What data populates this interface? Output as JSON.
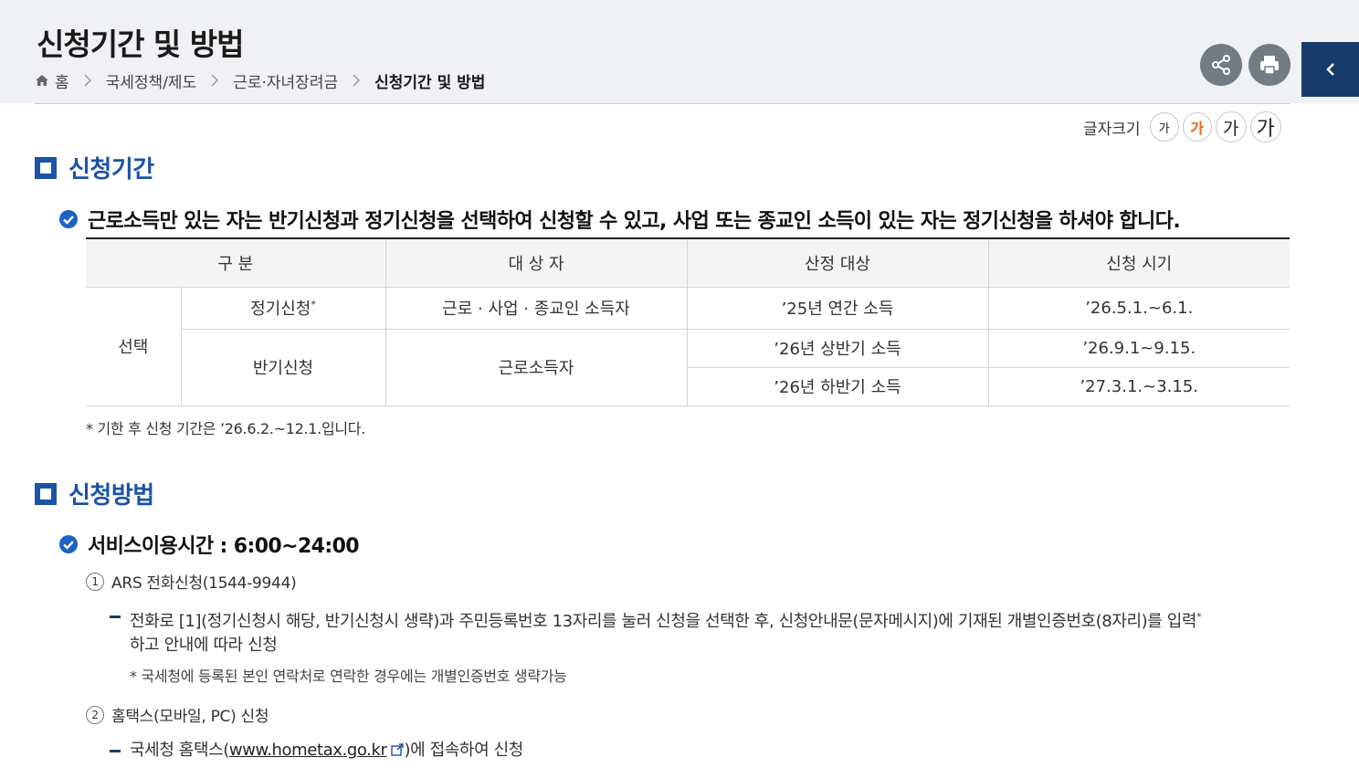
{
  "page": {
    "title": "신청기간 및 방법"
  },
  "breadcrumb": {
    "items": [
      "홈",
      "국세정책/제도",
      "근로·자녀장려금"
    ],
    "current": "신청기간 및 방법"
  },
  "toolbar": {
    "font_size_label": "글자크기",
    "font_size_options": [
      "가",
      "가",
      "가",
      "가"
    ]
  },
  "period_section": {
    "heading": "신청기간",
    "notice": "근로소득만 있는 자는 반기신청과 정기신청을 선택하여 신청할 수 있고, 사업 또는 종교인 소득이 있는 자는 정기신청을 하셔야 합니다.",
    "table": {
      "headers": [
        "구 분",
        "대 상 자",
        "산정 대상",
        "신청 시기"
      ],
      "group_label": "선택",
      "regular": {
        "label": "정기신청",
        "mark": "*",
        "target": "근로 · 사업 · 종교인 소득자",
        "basis": "’25년 연간 소득",
        "period": "’26.5.1.~6.1."
      },
      "half": {
        "label": "반기신청",
        "target": "근로소득자",
        "rows": [
          {
            "basis": "’26년 상반기 소득",
            "period": "’26.9.1~9.15."
          },
          {
            "basis": "’26년 하반기 소득",
            "period": "’27.3.1.~3.15."
          }
        ]
      }
    },
    "note": "* 기한 후 신청 기간은 ’26.6.2.~12.1.입니다."
  },
  "method_section": {
    "heading": "신청방법",
    "service_hours": "서비스이용시간 : 6:00~24:00",
    "items": [
      {
        "number": "1",
        "title": "ARS 전화신청(1544-9944)",
        "detail_line1": "전화로 [1](정기신청시 해당, 반기신청시 생략)과 주민등록번호 13자리를 눌러 신청을 선택한 후, 신청안내문(문자메시지)에 기재된 개별인증번호(8자리)를 입력",
        "detail_mark": "*",
        "detail_line2": "하고 안내에 따라 신청",
        "sub_note": "* 국세청에 등록된 본인 연락처로 연락한 경우에는 개별인증번호 생략가능"
      },
      {
        "number": "2",
        "title": "홈택스(모바일, PC) 신청",
        "detail_prefix": "국세청 홈택스(",
        "link_text": "www.hometax.go.kr",
        "detail_suffix": ")에 접속하여 신청"
      }
    ]
  },
  "colors": {
    "heading_blue": "#1b53a6",
    "nav_dark": "#173b6b",
    "button_gray": "#737b85",
    "active_font_orange": "#e06a1a"
  }
}
